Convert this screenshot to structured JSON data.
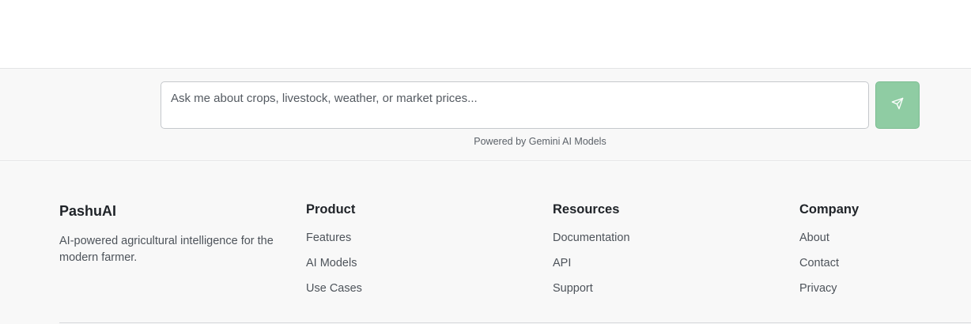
{
  "chat": {
    "input_placeholder": "Ask me about crops, livestock, weather, or market prices...",
    "input_value": "",
    "send_icon": "send-icon",
    "powered_by": "Powered by Gemini AI Models"
  },
  "footer": {
    "brand": {
      "name": "PashuAI",
      "tagline": "AI-powered agricultural intelligence for the modern farmer."
    },
    "columns": [
      {
        "heading": "Product",
        "links": [
          "Features",
          "AI Models",
          "Use Cases"
        ]
      },
      {
        "heading": "Resources",
        "links": [
          "Documentation",
          "API",
          "Support"
        ]
      },
      {
        "heading": "Company",
        "links": [
          "About",
          "Contact",
          "Privacy"
        ]
      }
    ]
  },
  "colors": {
    "send_button": "#8fcca3",
    "background": "#f8f8f8",
    "border": "#e3e4e6"
  }
}
